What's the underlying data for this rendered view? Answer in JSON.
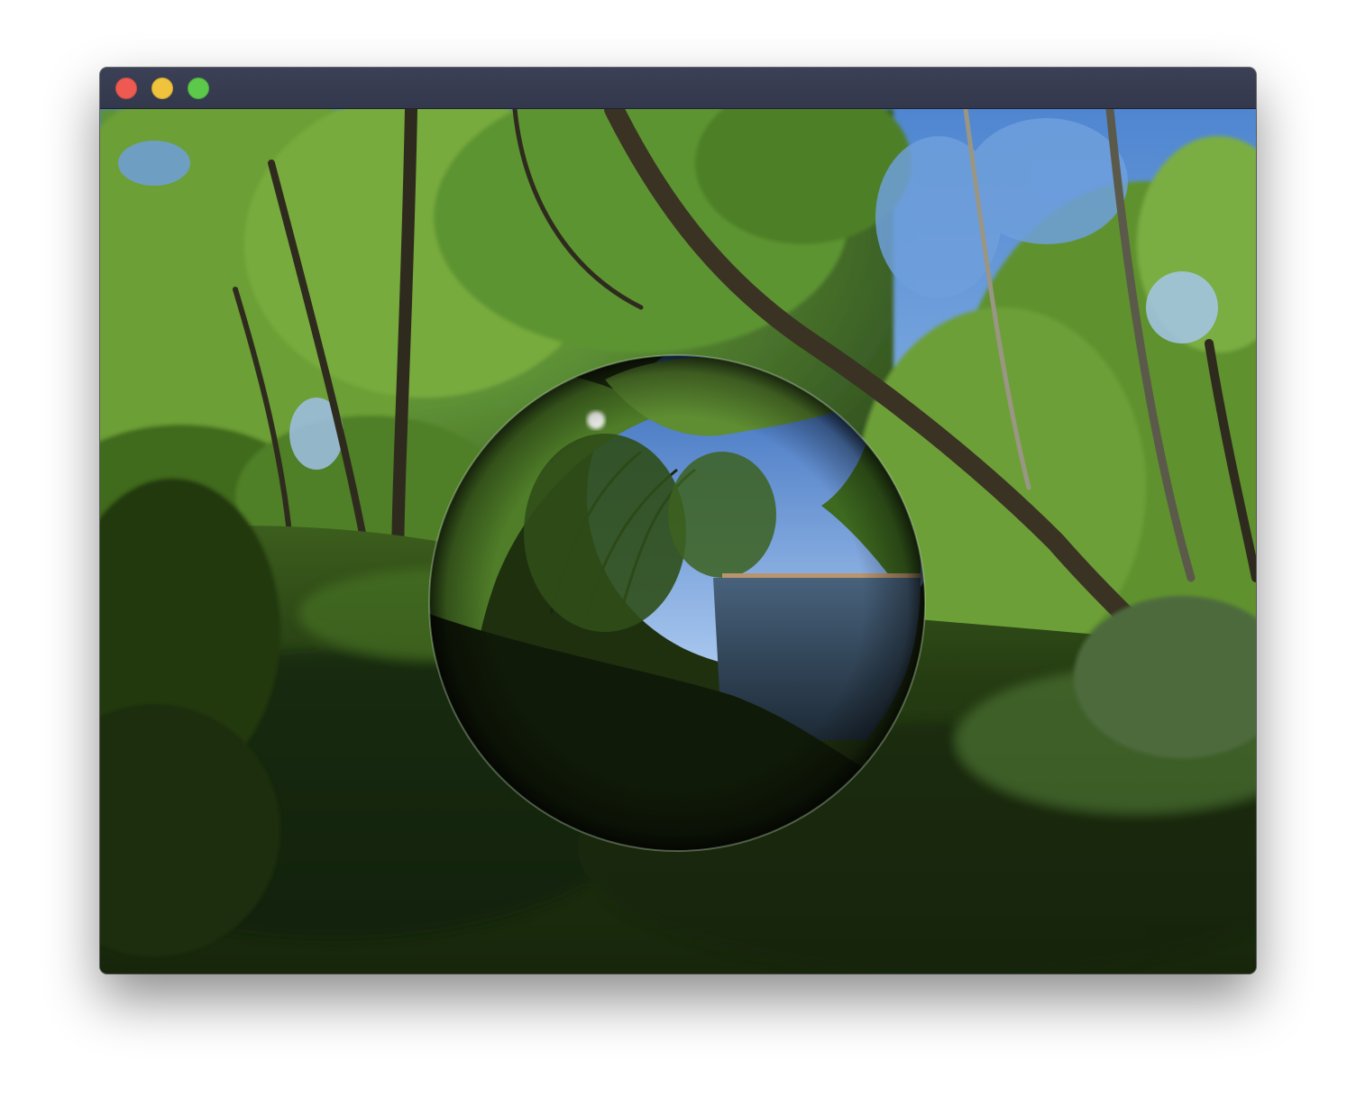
{
  "window": {
    "controls": [
      {
        "id": "close",
        "color": "#ee5a52"
      },
      {
        "id": "minimize",
        "color": "#f0c33c"
      },
      {
        "id": "maximize",
        "color": "#5cc94a"
      }
    ],
    "content": {
      "scene": "forest-panorama",
      "object": "mirror-sphere",
      "colors": {
        "sky": "#5f95d8",
        "foliage_light": "#6ea33a",
        "foliage_dark": "#20330f",
        "grass": "#2e4a17",
        "water": "#2c4156"
      }
    }
  }
}
